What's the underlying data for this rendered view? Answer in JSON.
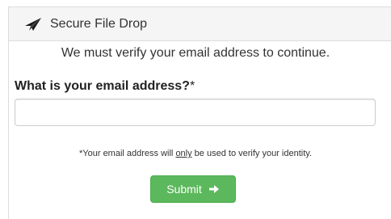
{
  "header": {
    "title": "Secure File Drop",
    "icon": "paper-plane-icon"
  },
  "form": {
    "intro": "We must verify your email address to continue.",
    "question": "What is your email address?",
    "required_marker": "*",
    "email_value": "",
    "note_before": "*Your email address will ",
    "note_emphasis": "only",
    "note_after": " be used to verify your identity.",
    "submit_label": "Submit",
    "submit_icon": "arrow-right-icon"
  },
  "colors": {
    "submit_bg": "#5cb85c",
    "header_bg": "#f5f5f5"
  }
}
